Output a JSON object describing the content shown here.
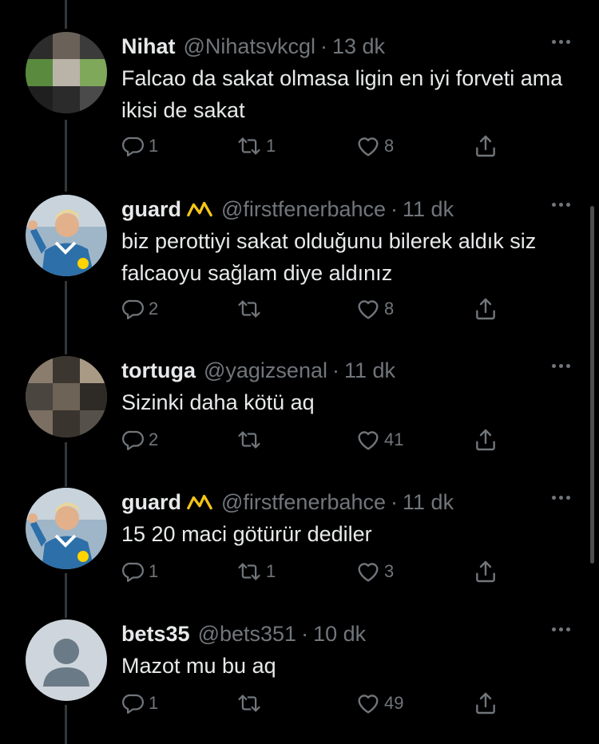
{
  "tweets": [
    {
      "name": "Nihat",
      "handle": "@Nihatsvkcgl",
      "time": "13 dk",
      "text": "Falcao da sakat olmasa ligin en iyi forveti ama ikisi de sakat",
      "replies": "1",
      "retweets": "1",
      "likes": "8",
      "verified_badge": false,
      "avatar": "pixelated"
    },
    {
      "name": "guard",
      "handle": "@firstfenerbahce",
      "time": "11 dk",
      "text": "biz perottiyi sakat olduğunu bilerek  aldık siz falcaoyu sağlam diye aldınız",
      "replies": "2",
      "retweets": "",
      "likes": "8",
      "verified_badge": true,
      "avatar": "coach-photo"
    },
    {
      "name": "tortuga",
      "handle": "@yagizsenal",
      "time": "11 dk",
      "text": "Sizinki daha kötü aq",
      "replies": "2",
      "retweets": "",
      "likes": "41",
      "verified_badge": false,
      "avatar": "pixelated"
    },
    {
      "name": "guard",
      "handle": "@firstfenerbahce",
      "time": "11 dk",
      "text": "15 20 maci götürür dediler",
      "replies": "1",
      "retweets": "1",
      "likes": "3",
      "verified_badge": true,
      "avatar": "coach-photo"
    },
    {
      "name": "bets35",
      "handle": "@bets351",
      "time": "10 dk",
      "text": "Mazot mu bu aq",
      "replies": "1",
      "retweets": "",
      "likes": "49",
      "verified_badge": false,
      "avatar": "default-placeholder"
    }
  ],
  "colors": {
    "background": "#000000",
    "text": "#e7e9ea",
    "secondary": "#71767b",
    "badge": "#f5c518"
  },
  "icons": [
    "reply-icon",
    "retweet-icon",
    "like-icon",
    "share-icon",
    "more-icon",
    "crown-badge-icon"
  ]
}
